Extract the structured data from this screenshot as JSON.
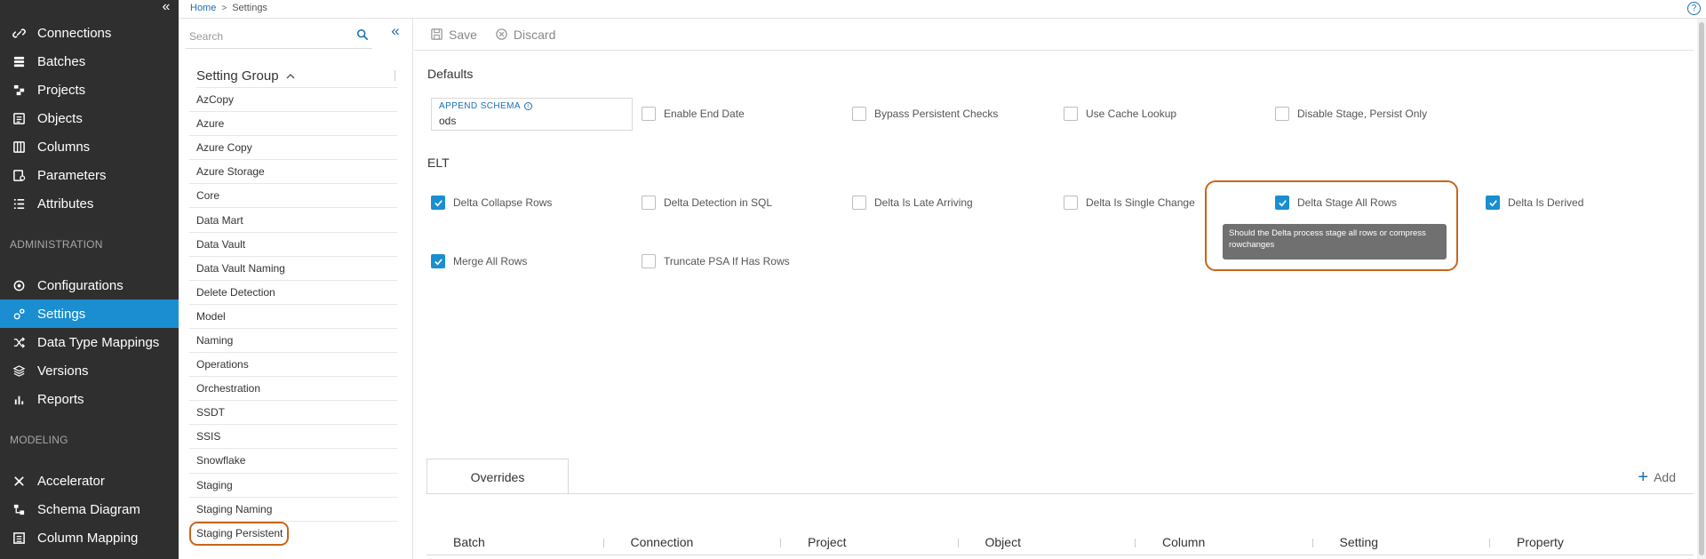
{
  "sidebar": {
    "items": [
      {
        "label": "Connections",
        "icon": "link-icon"
      },
      {
        "label": "Batches",
        "icon": "batches-icon"
      },
      {
        "label": "Projects",
        "icon": "projects-icon"
      },
      {
        "label": "Objects",
        "icon": "objects-icon"
      },
      {
        "label": "Columns",
        "icon": "columns-icon"
      },
      {
        "label": "Parameters",
        "icon": "parameters-icon"
      },
      {
        "label": "Attributes",
        "icon": "attributes-icon"
      }
    ],
    "admin_title": "ADMINISTRATION",
    "admin_items": [
      {
        "label": "Configurations",
        "icon": "configurations-icon"
      },
      {
        "label": "Settings",
        "icon": "settings-icon",
        "active": true
      },
      {
        "label": "Data Type Mappings",
        "icon": "shuffle-icon"
      },
      {
        "label": "Versions",
        "icon": "layers-icon"
      },
      {
        "label": "Reports",
        "icon": "bar-chart-icon"
      }
    ],
    "modeling_title": "MODELING",
    "modeling_items": [
      {
        "label": "Accelerator",
        "icon": "accelerator-icon"
      },
      {
        "label": "Schema Diagram",
        "icon": "schema-diagram-icon"
      },
      {
        "label": "Column Mapping",
        "icon": "column-mapping-icon"
      }
    ],
    "active_color": "#1a8ed1",
    "background": "#2f2f2f"
  },
  "breadcrumb": {
    "home": "Home",
    "current": "Settings"
  },
  "help_label": "?",
  "group_panel": {
    "search_placeholder": "Search",
    "header": "Setting Group",
    "groups": [
      "AzCopy",
      "Azure",
      "Azure Copy",
      "Azure Storage",
      "Core",
      "Data Mart",
      "Data Vault",
      "Data Vault Naming",
      "Delete Detection",
      "Model",
      "Naming",
      "Operations",
      "Orchestration",
      "SSDT",
      "SSIS",
      "Snowflake",
      "Staging",
      "Staging Naming",
      "Staging Persistent"
    ],
    "selected": "Staging Persistent"
  },
  "toolbar": {
    "save_label": "Save",
    "discard_label": "Discard"
  },
  "defaults": {
    "title": "Defaults",
    "append_schema": {
      "label": "APPEND SCHEMA",
      "value": "ods"
    },
    "checks": [
      {
        "label": "Enable End Date",
        "checked": false
      },
      {
        "label": "Bypass Persistent Checks",
        "checked": false
      },
      {
        "label": "Use Cache Lookup",
        "checked": false
      },
      {
        "label": "Disable Stage, Persist Only",
        "checked": false
      }
    ]
  },
  "elt": {
    "title": "ELT",
    "row1": [
      {
        "label": "Delta Collapse Rows",
        "checked": true
      },
      {
        "label": "Delta Detection in SQL",
        "checked": false
      },
      {
        "label": "Delta Is Late Arriving",
        "checked": false
      },
      {
        "label": "Delta Is Single Change",
        "checked": false
      },
      {
        "label": "Delta Stage All Rows",
        "checked": true
      },
      {
        "label": "Delta Is Derived",
        "checked": true
      }
    ],
    "row2": [
      {
        "label": "Merge All Rows",
        "checked": true
      },
      {
        "label": "Truncate PSA If Has Rows",
        "checked": false
      }
    ],
    "tooltip": "Should the Delta process stage all rows or compress rowchanges"
  },
  "overrides": {
    "tab": "Overrides",
    "add_label": "Add",
    "columns": [
      "Batch",
      "Connection",
      "Project",
      "Object",
      "Column",
      "Setting",
      "Property"
    ]
  },
  "colors": {
    "accent": "#1a8ed1",
    "link": "#1a6fb5",
    "highlight_outline": "#c8651b"
  }
}
